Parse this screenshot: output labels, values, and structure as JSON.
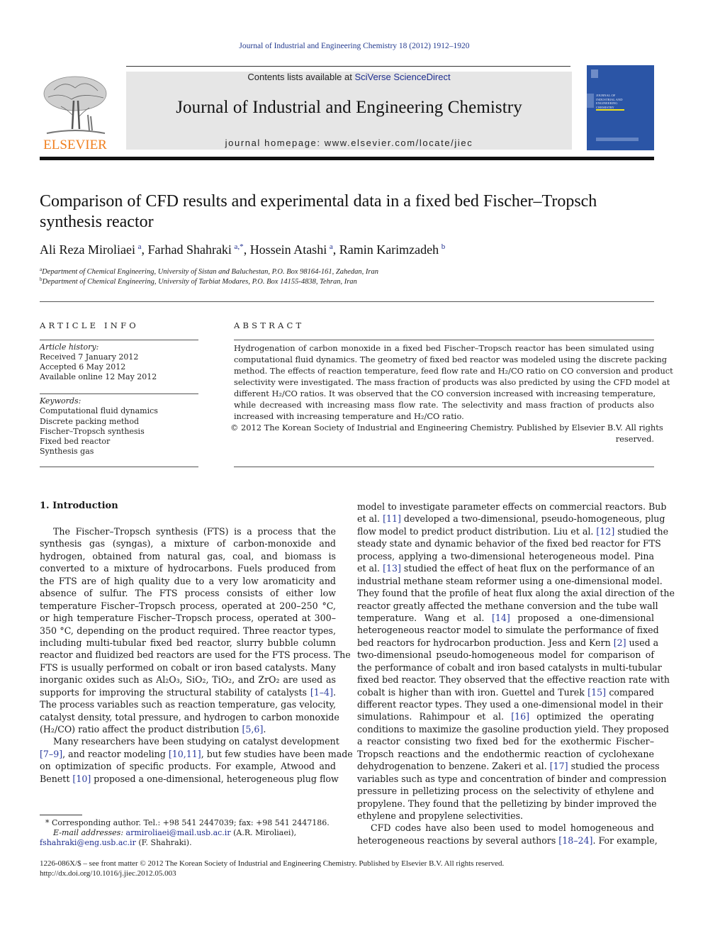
{
  "header": {
    "journal_ref": "Journal of Industrial and Engineering Chemistry 18 (2012) 1912–1920",
    "contents_prefix": "Contents lists available at ",
    "contents_link": "SciVerse ScienceDirect",
    "journal_title": "Journal of Industrial and Engineering Chemistry",
    "homepage": "journal homepage: www.elsevier.com/locate/jiec",
    "publisher_logo": "ELSEVIER",
    "cover_title_lines": [
      "JOURNAL OF",
      "INDUSTRIAL AND",
      "ENGINEERING",
      "CHEMISTRY"
    ]
  },
  "article": {
    "title_lines": [
      "Comparison of CFD results and experimental data in a fixed bed Fischer–Tropsch",
      "synthesis reactor"
    ],
    "authors": [
      {
        "name": "Ali Reza Miroliaei",
        "sup": "a"
      },
      {
        "name": "Farhad Shahraki",
        "sup": "a,*"
      },
      {
        "name": "Hossein Atashi",
        "sup": "a"
      },
      {
        "name": "Ramin Karimzadeh",
        "sup": "b"
      }
    ],
    "affiliations": [
      {
        "sup": "a",
        "text": "Department of Chemical Engineering, University of Sistan and Baluchestan, P.O. Box 98164-161, Zahedan, Iran"
      },
      {
        "sup": "b",
        "text": "Department of Chemical Engineering, University of Tarbiat Modares, P.O. Box 14155-4838, Tehran, Iran"
      }
    ]
  },
  "article_info": {
    "heading": "ARTICLE INFO",
    "history_label": "Article history:",
    "history": [
      "Received 7 January 2012",
      "Accepted 6 May 2012",
      "Available online 12 May 2012"
    ],
    "keywords_label": "Keywords:",
    "keywords": [
      "Computational fluid dynamics",
      "Discrete packing method",
      "Fischer–Tropsch synthesis",
      "Fixed bed reactor",
      "Synthesis gas"
    ]
  },
  "abstract": {
    "heading": "ABSTRACT",
    "lines": [
      "Hydrogenation of carbon monoxide in a fixed bed Fischer–Tropsch reactor has been simulated using",
      "computational fluid dynamics. The geometry of fixed bed reactor was modeled using the discrete packing",
      "method. The effects of reaction temperature, feed flow rate and H₂/CO ratio on CO conversion and product",
      "selectivity were investigated. The mass fraction of products was also predicted by using the CFD model at",
      "different H₂/CO ratios. It was observed that the CO conversion increased with increasing temperature,",
      "while decreased with increasing mass flow rate. The selectivity and mass fraction of products also",
      "increased with increasing temperature and H₂/CO ratio."
    ],
    "copyright_line1": "© 2012 The Korean Society of Industrial and Engineering Chemistry. Published by Elsevier B.V. All rights",
    "copyright_line2": "reserved."
  },
  "introduction": {
    "heading": "1.  Introduction",
    "left_lines": [
      "The Fischer–Tropsch synthesis (FTS) is a process that the",
      "synthesis gas (syngas), a mixture of carbon-monoxide and",
      "hydrogen, obtained from natural gas, coal, and biomass is",
      "converted to a mixture of hydrocarbons. Fuels produced from",
      "the FTS are of high quality due to a very low aromaticity and",
      "absence of sulfur. The FTS process consists of either low",
      "temperature Fischer–Tropsch process, operated at 200–250 °C,",
      "or high temperature Fischer–Tropsch process, operated at 300–",
      "350 °C, depending on the product required. Three reactor types,",
      "including multi-tubular fixed bed reactor, slurry bubble column",
      "reactor and fluidized bed reactors are used for the FTS process. The",
      "FTS is usually performed on cobalt or iron based catalysts. Many",
      "inorganic oxides such as Al₂O₃, SiO₂, TiO₂, and ZrO₂ are used as",
      "supports for improving the structural stability of catalysts [1–4].",
      "The process variables such as reaction temperature, gas velocity,",
      "catalyst density, total pressure, and hydrogen to carbon monoxide",
      "(H₂/CO) ratio affect the product distribution [5,6].",
      "Many researchers have been studying on catalyst development",
      "[7–9], and reactor modeling [10,11], but few studies have been made",
      "on optimization of specific products. For example, Atwood and",
      "Benett [10] proposed a one-dimensional, heterogeneous plug flow"
    ],
    "right_lines": [
      "model to investigate parameter effects on commercial reactors. Bub",
      "et al. [11] developed a two-dimensional, pseudo-homogeneous, plug",
      "flow model to predict product distribution. Liu et al. [12] studied the",
      "steady state and dynamic behavior of the fixed bed reactor for FTS",
      "process, applying a two-dimensional heterogeneous model. Pina",
      "et al. [13] studied the effect of heat flux on the performance of an",
      "industrial methane steam reformer using a one-dimensional model.",
      "They found that the profile of heat flux along the axial direction of the",
      "reactor greatly affected the methane conversion and the tube wall",
      "temperature. Wang et al. [14] proposed a one-dimensional",
      "heterogeneous reactor model to simulate the performance of fixed",
      "bed reactors for hydrocarbon production. Jess and Kern [2] used a",
      "two-dimensional pseudo-homogeneous model for comparison of",
      "the performance of cobalt and iron based catalysts in multi-tubular",
      "fixed bed reactor. They observed that the effective reaction rate with",
      "cobalt is higher than with iron. Guettel and Turek [15] compared",
      "different reactor types. They used a one-dimensional model in their",
      "simulations. Rahimpour et al. [16] optimized the operating",
      "conditions to maximize the gasoline production yield. They proposed",
      "a reactor consisting two fixed bed for the exothermic Fischer–",
      "Tropsch reactions and the endothermic reaction of cyclohexane",
      "dehydrogenation to benzene. Zakeri et al. [17] studied the process",
      "variables such as type and concentration of binder and compression",
      "pressure in pelletizing process on the selectivity of ethylene and",
      "propylene. They found that the pelletizing by binder improved the",
      "ethylene and propylene selectivities.",
      "CFD codes have also been used to model homogeneous and",
      "heterogeneous reactions by several authors [18–24]. For example,"
    ]
  },
  "footnote": {
    "line1": "* Corresponding author. Tel.: +98 541 2447039; fax: +98 541 2447186.",
    "email_label": "E-mail addresses: ",
    "email1": "armiroliaei@mail.usb.ac.ir",
    "email1_owner": " (A.R. Miroliaei),",
    "email2": "fshahraki@eng.usb.ac.ir",
    "email2_owner": " (F. Shahraki)."
  },
  "bottom": {
    "front_matter": "1226-086X/$ – see front matter © 2012 The Korean Society of Industrial and Engineering Chemistry. Published by Elsevier B.V. All rights reserved.",
    "doi": "http://dx.doi.org/10.1016/j.jiec.2012.05.003"
  }
}
